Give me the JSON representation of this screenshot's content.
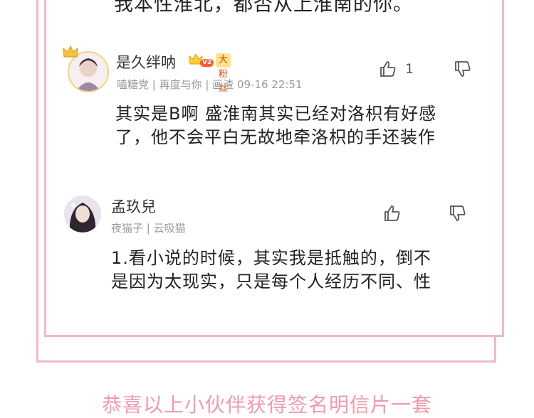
{
  "cut_line": "我本性淮北，都否从上淮南的你。",
  "comments": [
    {
      "username": "是久绊呐",
      "level_badge": "V2",
      "fan_badge": "大粉丝",
      "meta": "嗑糖党 | 再度与你 | 画渣   09-16 22:51",
      "like_count": "1",
      "body_line1": "其实是B啊 盛淮南其实已经对洛枳有好感",
      "body_line2": "了，他不会平白无故地牵洛枳的手还装作"
    },
    {
      "username": "孟玖兒",
      "meta": "夜猫子 | 云吸猫",
      "body_line1": "1.看小说的时候，其实我是抵触的，倒不",
      "body_line2": "是因为太现实，只是每个人经历不同、性"
    }
  ],
  "footer_text": "恭喜以上小伙伴获得签名明信片一套",
  "colors": {
    "frame": "#f3b9c3",
    "footer": "#f19aab",
    "fan_badge_bg": "#ffe28a"
  },
  "icons": [
    "crown-icon",
    "thumbs-up-icon",
    "thumbs-down-icon"
  ]
}
